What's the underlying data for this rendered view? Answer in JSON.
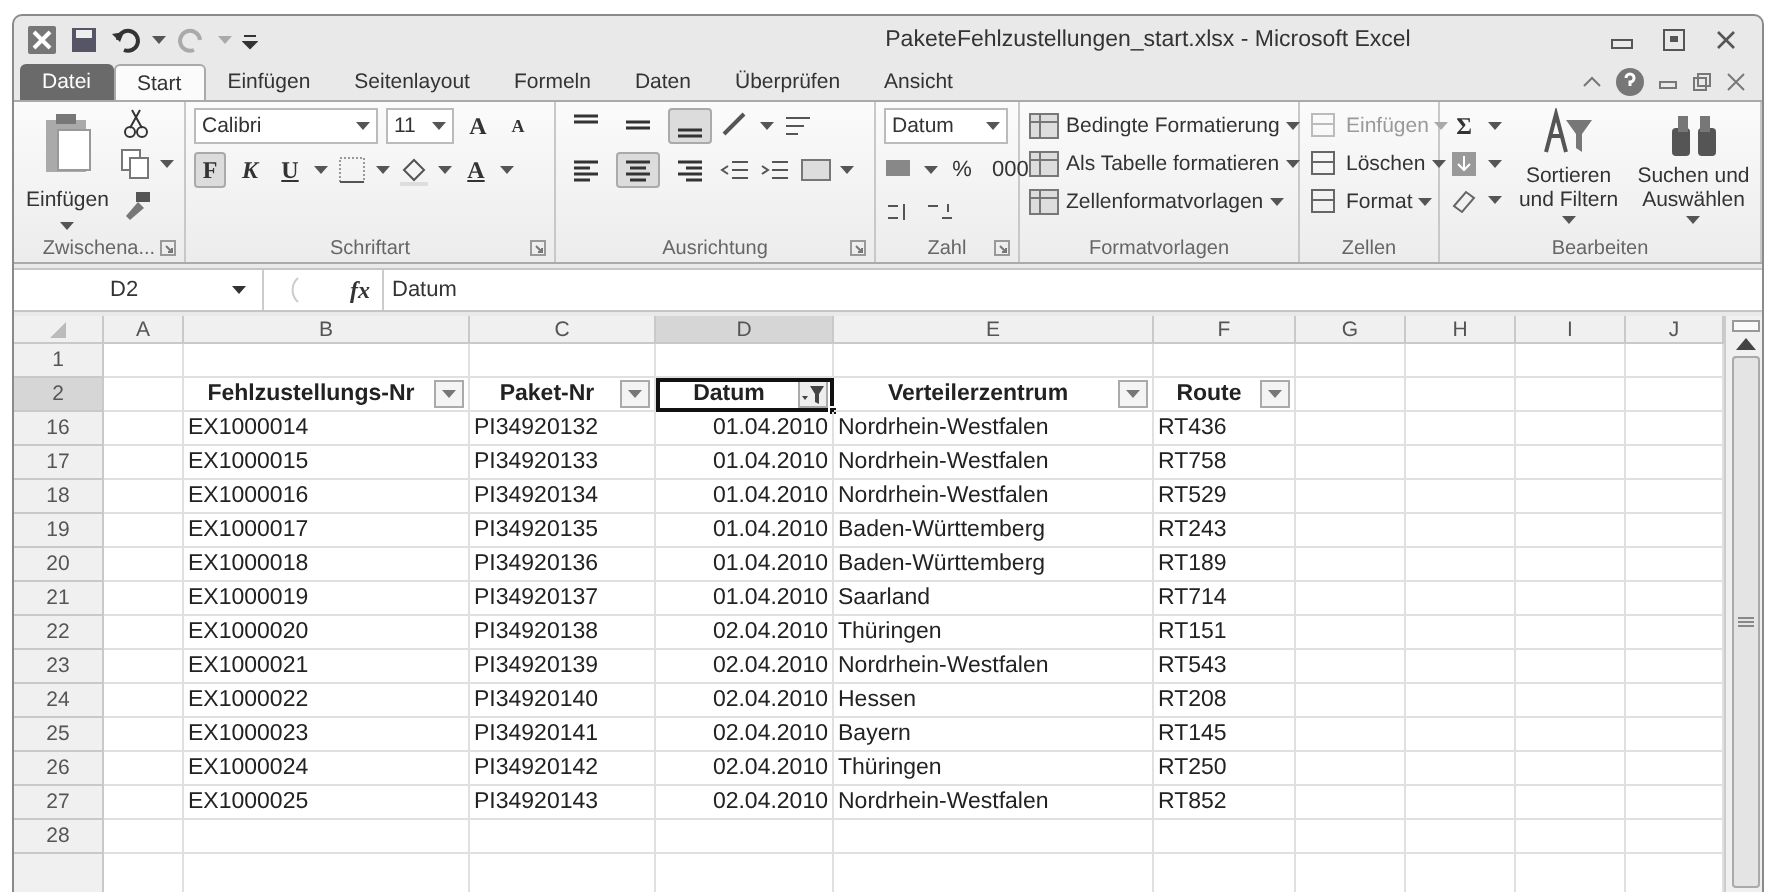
{
  "window": {
    "title": "PaketeFehlzustellungen_start.xlsx - Microsoft Excel"
  },
  "tabs": [
    {
      "label": "Datei",
      "kind": "file",
      "selected": false
    },
    {
      "label": "Start",
      "kind": "tab",
      "selected": true
    },
    {
      "label": "Einfügen",
      "kind": "tab",
      "selected": false
    },
    {
      "label": "Seitenlayout",
      "kind": "tab",
      "selected": false
    },
    {
      "label": "Formeln",
      "kind": "tab",
      "selected": false
    },
    {
      "label": "Daten",
      "kind": "tab",
      "selected": false
    },
    {
      "label": "Überprüfen",
      "kind": "tab",
      "selected": false
    },
    {
      "label": "Ansicht",
      "kind": "tab",
      "selected": false
    }
  ],
  "ribbon": {
    "clipboard": {
      "paste": "Einfügen",
      "label": "Zwischena..."
    },
    "font": {
      "name": "Calibri",
      "size": "11",
      "grow": "A",
      "shrink": "A",
      "bold": "F",
      "italic": "K",
      "underline": "U",
      "font_color": "A",
      "label": "Schriftart"
    },
    "alignment": {
      "label": "Ausrichtung",
      "controls": [
        {
          "kind": "top",
          "selected": false
        },
        {
          "kind": "middle",
          "selected": false
        },
        {
          "kind": "bottom",
          "selected": true
        },
        {
          "kind": "left",
          "selected": false
        },
        {
          "kind": "center",
          "selected": true
        },
        {
          "kind": "right",
          "selected": false
        }
      ]
    },
    "number": {
      "format": "Datum",
      "percent": "%",
      "thousands": "000",
      "label": "Zahl"
    },
    "styles": {
      "items": [
        "Bedingte Formatierung",
        "Als Tabelle formatieren",
        "Zellenformatvorlagen"
      ],
      "label": "Formatvorlagen"
    },
    "cells": {
      "items": [
        {
          "label": "Einfügen",
          "disabled": true
        },
        {
          "label": "Löschen",
          "disabled": false
        },
        {
          "label": "Format",
          "disabled": false
        }
      ],
      "label": "Zellen"
    },
    "editing": {
      "sum": "Σ",
      "sort": "Sortieren und Filtern",
      "find": "Suchen und Auswählen",
      "label": "Bearbeiten"
    }
  },
  "formula_bar": {
    "name_box": "D2",
    "fx": "fx",
    "formula": "Datum"
  },
  "sheet": {
    "columns": [
      {
        "label": "A",
        "selected": false
      },
      {
        "label": "B",
        "selected": false
      },
      {
        "label": "C",
        "selected": false
      },
      {
        "label": "D",
        "selected": true
      },
      {
        "label": "E",
        "selected": false
      },
      {
        "label": "F",
        "selected": false
      },
      {
        "label": "G",
        "selected": false
      },
      {
        "label": "H",
        "selected": false
      },
      {
        "label": "I",
        "selected": false
      },
      {
        "label": "J",
        "selected": false
      }
    ],
    "rows": [
      {
        "number": "1",
        "selected": false
      },
      {
        "number": "2",
        "kind": "header",
        "selected": true,
        "cells": [
          {
            "text": "Fehlzustellungs-Nr",
            "filtered": false,
            "active": false
          },
          {
            "text": "Paket-Nr",
            "filtered": false,
            "active": false
          },
          {
            "text": "Datum",
            "filtered": true,
            "active": true
          },
          {
            "text": "Verteilerzentrum",
            "filtered": false,
            "active": false
          },
          {
            "text": "Route",
            "filtered": false,
            "active": false
          }
        ]
      },
      {
        "number": "16",
        "kind": "data",
        "selected": false,
        "cells": [
          {
            "text": "EX1000014"
          },
          {
            "text": "PI34920132"
          },
          {
            "text": "01.04.2010"
          },
          {
            "text": "Nordrhein-Westfalen"
          },
          {
            "text": "RT436"
          }
        ]
      },
      {
        "number": "17",
        "kind": "data",
        "selected": false,
        "cells": [
          {
            "text": "EX1000015"
          },
          {
            "text": "PI34920133"
          },
          {
            "text": "01.04.2010"
          },
          {
            "text": "Nordrhein-Westfalen"
          },
          {
            "text": "RT758"
          }
        ]
      },
      {
        "number": "18",
        "kind": "data",
        "selected": false,
        "cells": [
          {
            "text": "EX1000016"
          },
          {
            "text": "PI34920134"
          },
          {
            "text": "01.04.2010"
          },
          {
            "text": "Nordrhein-Westfalen"
          },
          {
            "text": "RT529"
          }
        ]
      },
      {
        "number": "19",
        "kind": "data",
        "selected": false,
        "cells": [
          {
            "text": "EX1000017"
          },
          {
            "text": "PI34920135"
          },
          {
            "text": "01.04.2010"
          },
          {
            "text": "Baden-Württemberg"
          },
          {
            "text": "RT243"
          }
        ]
      },
      {
        "number": "20",
        "kind": "data",
        "selected": false,
        "cells": [
          {
            "text": "EX1000018"
          },
          {
            "text": "PI34920136"
          },
          {
            "text": "01.04.2010"
          },
          {
            "text": "Baden-Württemberg"
          },
          {
            "text": "RT189"
          }
        ]
      },
      {
        "number": "21",
        "kind": "data",
        "selected": false,
        "cells": [
          {
            "text": "EX1000019"
          },
          {
            "text": "PI34920137"
          },
          {
            "text": "01.04.2010"
          },
          {
            "text": "Saarland"
          },
          {
            "text": "RT714"
          }
        ]
      },
      {
        "number": "22",
        "kind": "data",
        "selected": false,
        "cells": [
          {
            "text": "EX1000020"
          },
          {
            "text": "PI34920138"
          },
          {
            "text": "02.04.2010"
          },
          {
            "text": "Thüringen"
          },
          {
            "text": "RT151"
          }
        ]
      },
      {
        "number": "23",
        "kind": "data",
        "selected": false,
        "cells": [
          {
            "text": "EX1000021"
          },
          {
            "text": "PI34920139"
          },
          {
            "text": "02.04.2010"
          },
          {
            "text": "Nordrhein-Westfalen"
          },
          {
            "text": "RT543"
          }
        ]
      },
      {
        "number": "24",
        "kind": "data",
        "selected": false,
        "cells": [
          {
            "text": "EX1000022"
          },
          {
            "text": "PI34920140"
          },
          {
            "text": "02.04.2010"
          },
          {
            "text": "Hessen"
          },
          {
            "text": "RT208"
          }
        ]
      },
      {
        "number": "25",
        "kind": "data",
        "selected": false,
        "cells": [
          {
            "text": "EX1000023"
          },
          {
            "text": "PI34920141"
          },
          {
            "text": "02.04.2010"
          },
          {
            "text": "Bayern"
          },
          {
            "text": "RT145"
          }
        ]
      },
      {
        "number": "26",
        "kind": "data",
        "selected": false,
        "cells": [
          {
            "text": "EX1000024"
          },
          {
            "text": "PI34920142"
          },
          {
            "text": "02.04.2010"
          },
          {
            "text": "Thüringen"
          },
          {
            "text": "RT250"
          }
        ]
      },
      {
        "number": "27",
        "kind": "data",
        "selected": false,
        "cells": [
          {
            "text": "EX1000025"
          },
          {
            "text": "PI34920143"
          },
          {
            "text": "02.04.2010"
          },
          {
            "text": "Nordrhein-Westfalen"
          },
          {
            "text": "RT852"
          }
        ]
      },
      {
        "number": "28",
        "selected": false
      }
    ]
  }
}
